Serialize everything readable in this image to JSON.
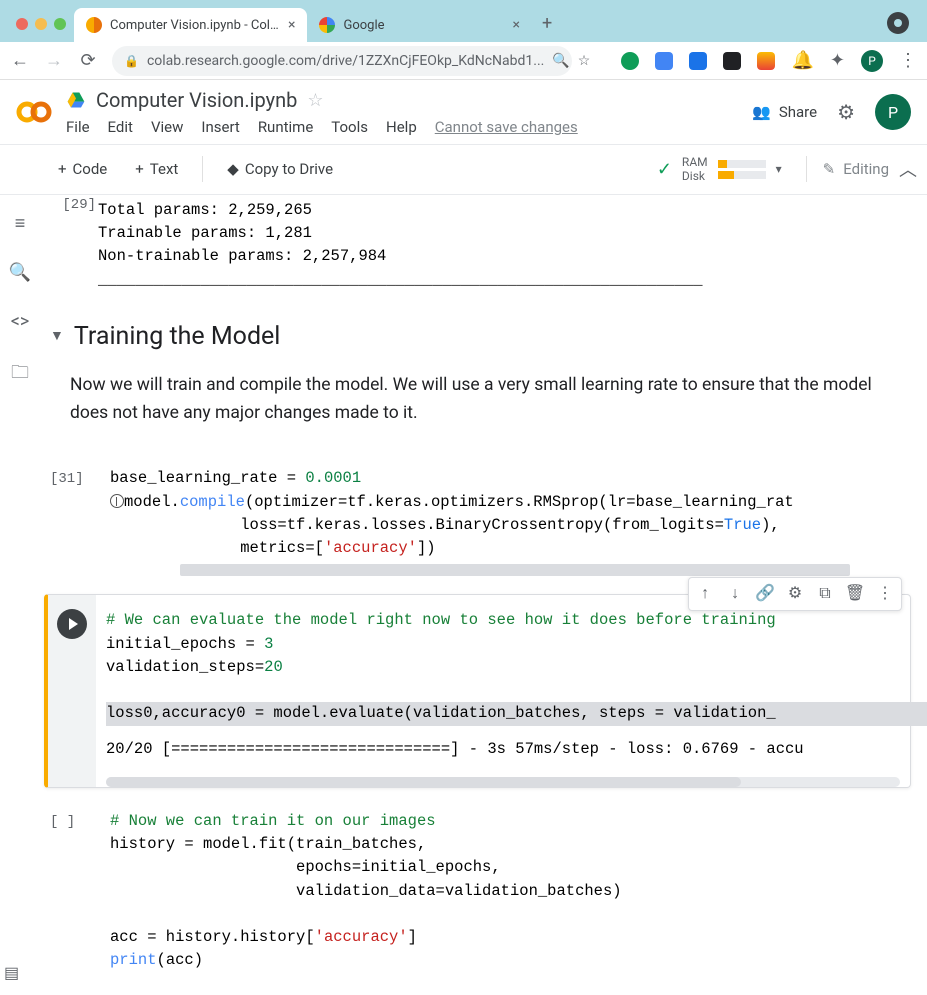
{
  "browser": {
    "tabs": [
      {
        "title": "Computer Vision.ipynb - Colab",
        "close": "×"
      },
      {
        "title": "Google",
        "close": "×"
      }
    ],
    "url_display": "colab.research.google.com/drive/1ZZXnCjFEOkp_KdNcNabd1...",
    "avatar_letter": "P"
  },
  "header": {
    "title": "Computer Vision.ipynb",
    "menus": [
      "File",
      "Edit",
      "View",
      "Insert",
      "Runtime",
      "Tools",
      "Help"
    ],
    "cannot_save": "Cannot save changes",
    "share": "Share"
  },
  "toolbar": {
    "code": "Code",
    "text": "Text",
    "copy": "Copy to Drive",
    "ram": "RAM",
    "disk": "Disk",
    "editing": "Editing"
  },
  "output_prev": {
    "exec": "[29]",
    "line1": "Total params: 2,259,265",
    "line2": "Trainable params: 1,281",
    "line3": "Non-trainable params: 2,257,984",
    "rule": "_________________________________________________________________"
  },
  "section": {
    "title": "Training the Model",
    "body": "Now we will train and compile the model. We will use a very small learning rate to ensure that the model does not have any major changes made to it."
  },
  "cell31": {
    "exec": "[31]",
    "l1a": "base_learning_rate = ",
    "l1b": "0.0001",
    "l2a": "model.",
    "l2b": "compile",
    "l2c": "(optimizer=tf.keras.optimizers.RMSprop(lr=base_learning_rat",
    "l3a": "              loss=tf.keras.losses.BinaryCrossentropy(from_logits=",
    "l3b": "True",
    "l3c": "),",
    "l4a": "              metrics=[",
    "l4b": "'accuracy'",
    "l4c": "])"
  },
  "active_cell": {
    "c1": "# We can evaluate the model right now to see how it does before training",
    "l2a": "initial_epochs = ",
    "l2b": "3",
    "l3a": "validation_steps=",
    "l3b": "20",
    "l4": "",
    "l5": "loss0,accuracy0 = model.evaluate(validation_batches, steps = validation_",
    "out": "20/20 [==============================] - 3s 57ms/step - loss: 0.6769 - accu"
  },
  "cell_next": {
    "exec": "[ ]",
    "c1": "# Now we can train it on our images",
    "l2": "history = model.fit(train_batches,",
    "l3": "                    epochs=initial_epochs,",
    "l4": "                    validation_data=validation_batches)",
    "l5": "",
    "l6a": "acc = history.history[",
    "l6b": "'accuracy'",
    "l6c": "]",
    "l7a": "print",
    "l7b": "(acc)"
  }
}
